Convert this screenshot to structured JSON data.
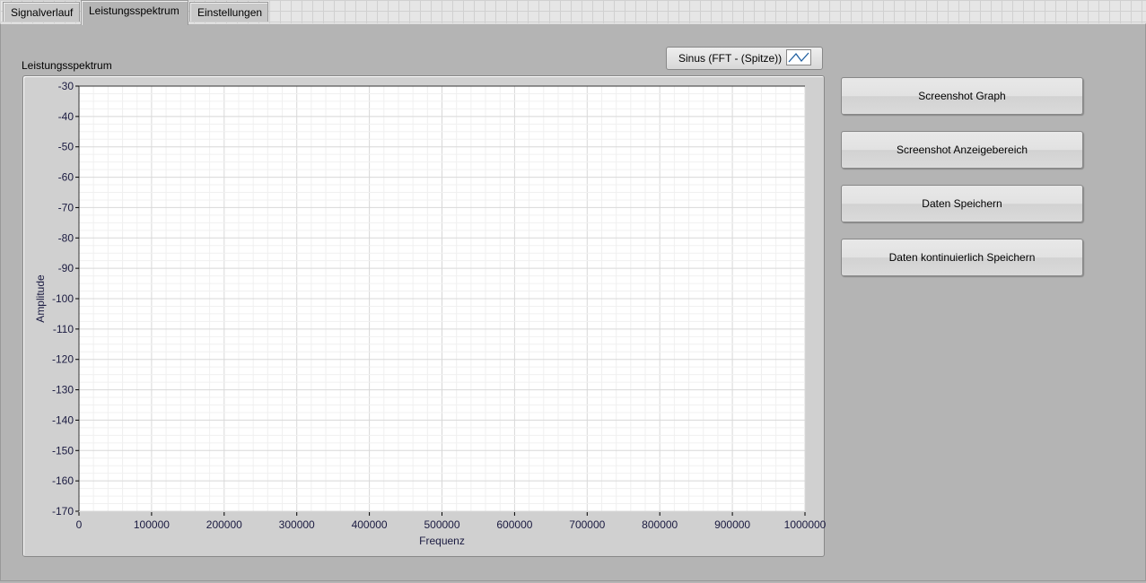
{
  "tabs": [
    {
      "label": "Signalverlauf"
    },
    {
      "label": "Leistungsspektrum",
      "active": true
    },
    {
      "label": "Einstellungen"
    }
  ],
  "graph": {
    "title": "Leistungsspektrum",
    "legend": "Sinus (FFT - (Spitze))",
    "plot_color": "#1f5fa0"
  },
  "buttons": {
    "screenshot_graph": "Screenshot Graph",
    "screenshot_area": "Screenshot Anzeigebereich",
    "save_data": "Daten Speichern",
    "save_continuous": "Daten kontinuierlich Speichern"
  },
  "chart_data": {
    "type": "line",
    "title": "Leistungsspektrum",
    "xlabel": "Frequenz",
    "ylabel": "Amplitude",
    "xlim": [
      0,
      1000000
    ],
    "ylim": [
      -170,
      -30
    ],
    "xticks": [
      "0",
      "100000",
      "200000",
      "300000",
      "400000",
      "500000",
      "600000",
      "700000",
      "800000",
      "900000",
      "1000000"
    ],
    "yticks": [
      "-30",
      "-40",
      "-50",
      "-60",
      "-70",
      "-80",
      "-90",
      "-100",
      "-110",
      "-120",
      "-130",
      "-140",
      "-150",
      "-160",
      "-170"
    ],
    "series": [
      {
        "name": "Sinus (FFT - (Spitze))",
        "values": []
      }
    ],
    "grid": true,
    "legend_position": "top-right"
  }
}
